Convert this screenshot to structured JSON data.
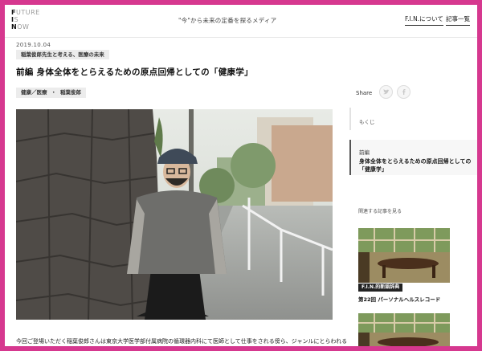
{
  "header": {
    "logo": [
      "F",
      "UTURE",
      "I",
      "S",
      "N",
      "OW"
    ],
    "tagline": "\"今\"から未来の定番を探るメディア",
    "nav_about": "F.I.N.について",
    "nav_list": "記事一覧"
  },
  "article": {
    "date": "2019.10.04",
    "series": "稲葉俊郎先生と考える、医療の未来",
    "title": "前編 身体全体をとらえるための原点回帰としての「健康学」",
    "categories": [
      "健康／医療",
      "・",
      "稲葉俊郎"
    ],
    "lead": "今回ご登場いただく稲葉俊郎さんは東京大学医学部付属病院の循環器内科にて医師として仕事をされる傍ら、ジャンルにとらわれる"
  },
  "share": {
    "label": "Share",
    "twitter_icon": "twitter-icon",
    "facebook_icon": "facebook-icon"
  },
  "sidebar": {
    "toc_label": "もくじ",
    "toc_items": [
      {
        "kicker": "前編",
        "title": "身体全体をとらえるための原点回帰としての「健康学」"
      }
    ],
    "related_label": "関連する記事を見る",
    "related": [
      {
        "category": "F.I.N.的新語辞典",
        "title": "第22回 パーソナルヘルスレコード"
      }
    ]
  },
  "colors": {
    "frame": "#d6388f",
    "tag_bg": "#ececec",
    "accent_dark": "#222222"
  }
}
